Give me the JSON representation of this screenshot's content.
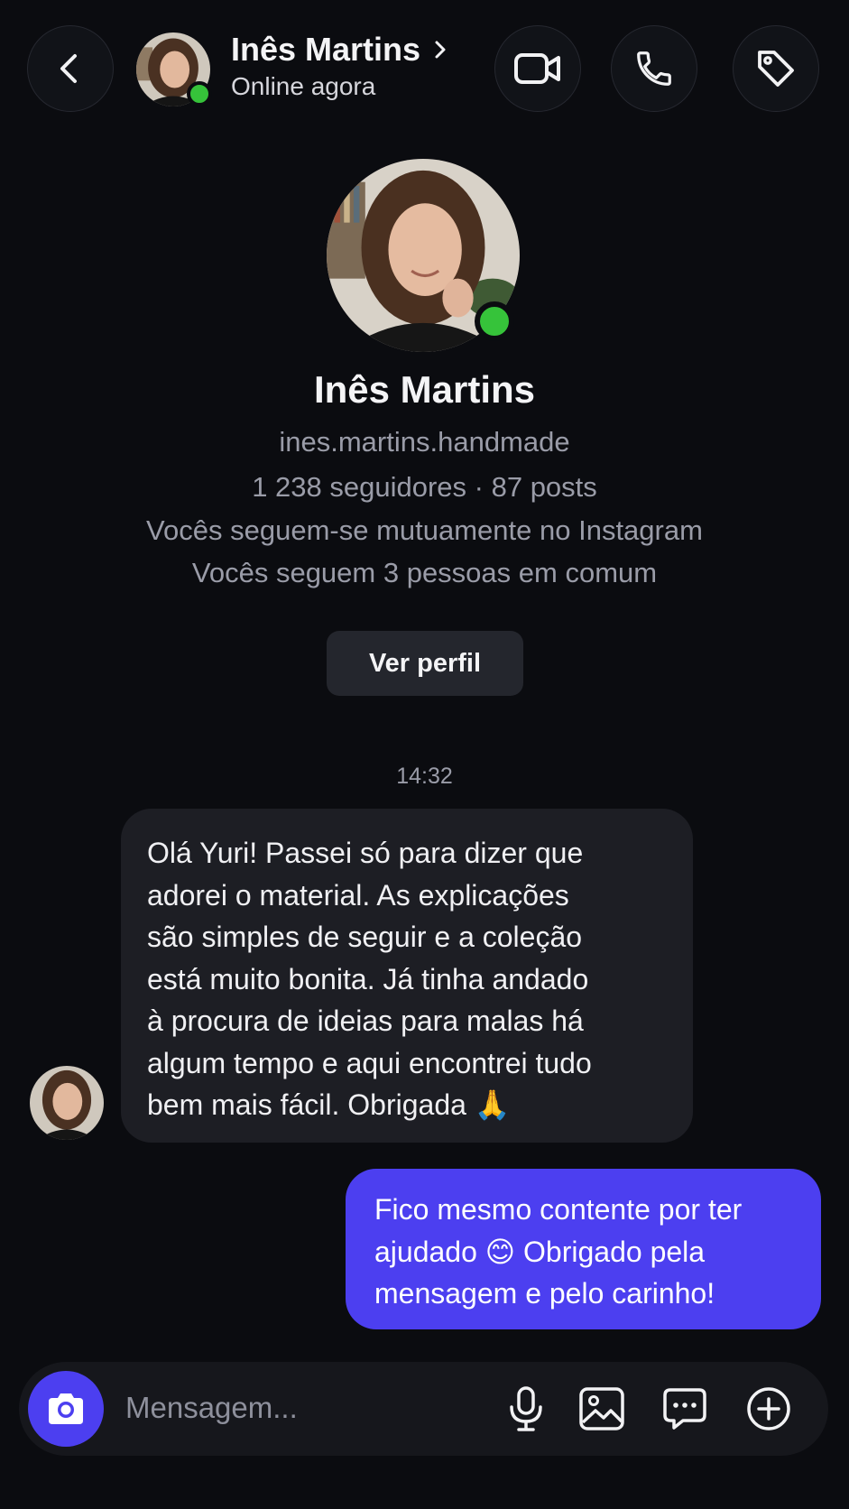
{
  "header": {
    "name": "Inês Martins",
    "status": "Online agora",
    "icons": [
      "back-icon",
      "video-call-icon",
      "phone-icon",
      "tag-icon"
    ]
  },
  "profile": {
    "name": "Inês Martins",
    "username": "ines.martins.handmade",
    "stats": "1 238 seguidores · 87 posts",
    "mutual_follow": "Vocês seguem-se mutuamente no Instagram",
    "common_follows": "Vocês seguem 3 pessoas em comum",
    "view_profile_label": "Ver perfil"
  },
  "conversation": {
    "timestamp": "14:32",
    "messages": [
      {
        "from": "contact",
        "lines": [
          "Olá Yuri! Passei só para dizer que",
          "adorei o material. As explicações",
          "são simples de seguir e a coleção",
          "está muito bonita. Já tinha andado",
          "à procura de ideias para malas há",
          "algum tempo e aqui encontrei tudo",
          "bem mais fácil. Obrigada 🙏"
        ]
      },
      {
        "from": "me",
        "lines": [
          "Fico mesmo contente por ter",
          "ajudado 😊 Obrigado pela",
          "mensagem e pelo carinho!"
        ]
      }
    ]
  },
  "composer": {
    "placeholder": "Mensagem...",
    "icons": [
      "camera-icon",
      "microphone-icon",
      "gallery-icon",
      "chat-options-icon",
      "add-icon"
    ]
  },
  "colors": {
    "background": "#0b0c10",
    "accent": "#4c3ff0",
    "online": "#36c33a",
    "incoming_bubble": "#1d1e24"
  }
}
